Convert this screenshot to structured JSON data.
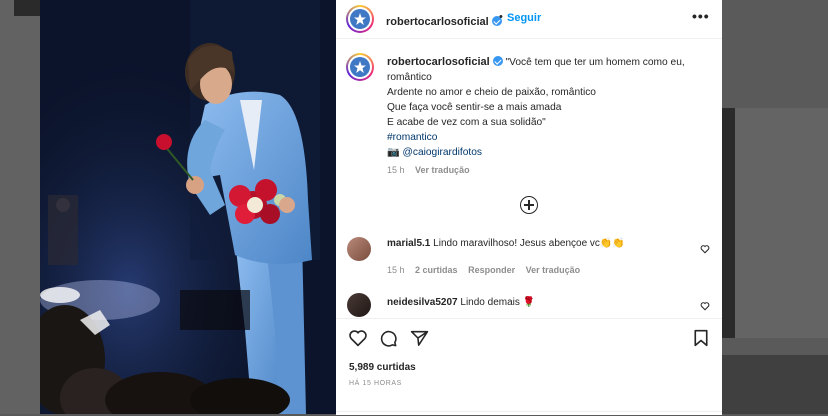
{
  "post": {
    "username": "robertocarlosoficial",
    "follow_label": "Seguir",
    "separator": "•",
    "more_label": "•••",
    "caption_lines": [
      "\"Você tem que ter um homem como eu,",
      "romântico",
      "Ardente no amor e cheio de paixão, romântico",
      "Que faça você sentir-se a mais amada",
      "E acabe de vez com a sua solidão\""
    ],
    "hashtag": "#romantico",
    "camera_emoji": "📷",
    "credit": "@caiogirardifotos",
    "caption_time": "15 h",
    "translate_label": "Ver tradução"
  },
  "comments": [
    {
      "username": "marial5.1",
      "text": "Lindo maravilhoso! Jesus abençoe vc",
      "emoji": "👏👏",
      "time": "15 h",
      "likes": "2 curtidas",
      "reply_label": "Responder",
      "translate_label": "Ver tradução"
    },
    {
      "username": "neidesilva5207",
      "text": "Lindo demais",
      "emoji": "🌹"
    }
  ],
  "footer": {
    "likes": "5,989 curtidas",
    "posted": "HÁ 15 HORAS"
  },
  "colors": {
    "accent": "#0095f6",
    "verified": "#3897f0",
    "text": "#262626",
    "muted": "#8e8e8e",
    "hashtag": "#00376b",
    "suit": "#6fa6dc"
  },
  "icons": {
    "header_avatar": "profile-avatar-icon",
    "verified": "verified-badge-icon",
    "add_comment": "plus-circle-icon",
    "like": "heart-icon",
    "comment": "comment-icon",
    "share": "share-icon",
    "save": "bookmark-icon"
  }
}
